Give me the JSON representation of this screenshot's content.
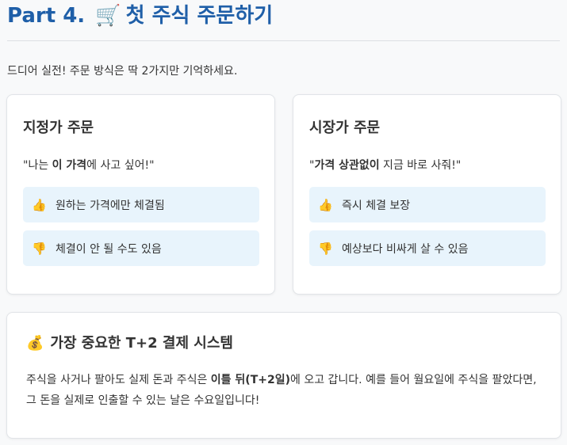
{
  "header": {
    "part": "Part 4.",
    "icon": "shopping-cart-icon",
    "icon_glyph": "🛒",
    "title": "첫 주식 주문하기"
  },
  "intro": "드디어 실전! 주문 방식은 딱 2가지만 기억하세요.",
  "limit_order": {
    "title": "지정가 주문",
    "quote_pre": "\"나는 ",
    "quote_bold": "이 가격",
    "quote_post": "에 사고 싶어!\"",
    "pro_icon": "thumbs-up-icon",
    "pro_glyph": "👍",
    "pro": "원하는 가격에만 체결됨",
    "con_icon": "thumbs-down-icon",
    "con_glyph": "👎",
    "con": "체결이 안 될 수도 있음"
  },
  "market_order": {
    "title": "시장가 주문",
    "quote_pre": "\"",
    "quote_bold": "가격 상관없이",
    "quote_post": " 지금 바로 사줘!\"",
    "pro_icon": "thumbs-up-icon",
    "pro_glyph": "👍",
    "pro": "즉시 체결 보장",
    "con_icon": "thumbs-down-icon",
    "con_glyph": "👎",
    "con": "예상보다 비싸게 살 수 있음"
  },
  "settlement": {
    "icon": "money-bag-icon",
    "icon_glyph": "💰",
    "title": "가장 중요한 T+2 결제 시스템",
    "para_pre": "주식을 사거나 팔아도 실제 돈과 주식은 ",
    "para_bold": "이틀 뒤(T+2일)",
    "para_post": "에 오고 갑니다. 예를 들어 월요일에 주식을 팔았다면, 그 돈을 실제로 인출할 수 있는 날은 수요일입니다!"
  }
}
